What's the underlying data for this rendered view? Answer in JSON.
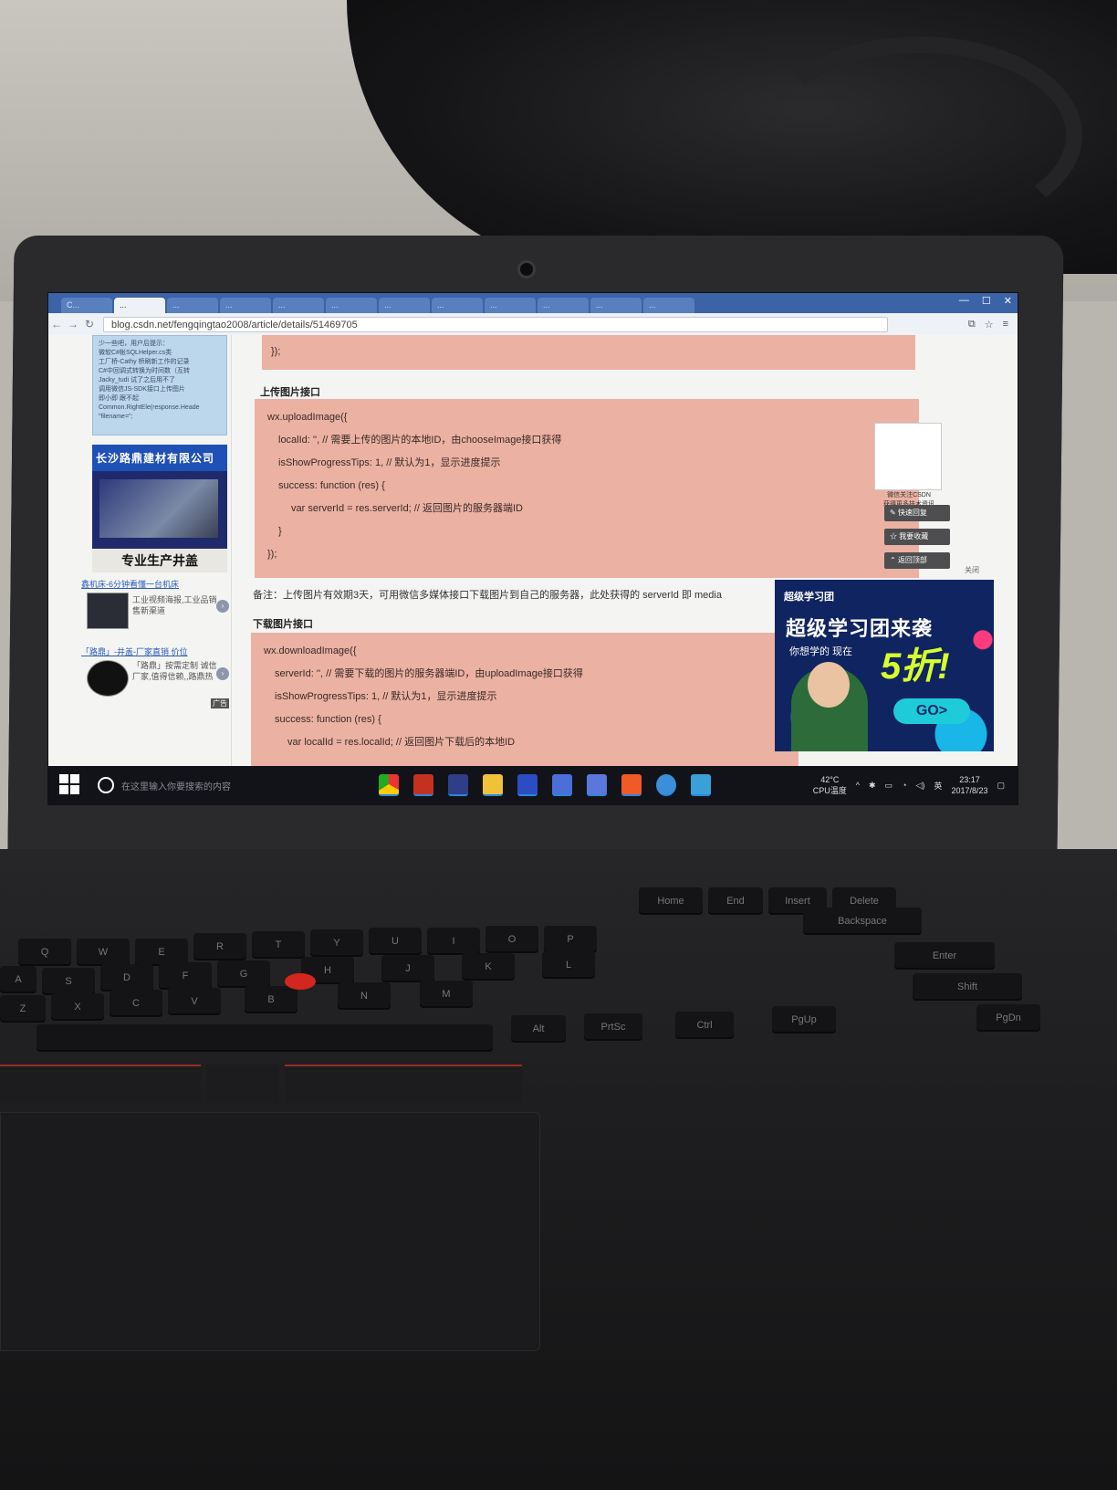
{
  "browser": {
    "url": "blog.csdn.net/fengqingtao2008/article/details/51469705",
    "tabs": [
      "C...",
      "...",
      "...",
      "...",
      "...",
      "...",
      "...",
      "...",
      "...",
      "...",
      "...",
      "..."
    ]
  },
  "sidebar": {
    "box_lines": [
      "少一些吧，用户后提示：",
      "微软C#帐SQLHelper.cs类",
      "工厂桥-Cathy 桥刷新工作的记录",
      "C#中回调式转换为时间数（互转",
      "Jacky_tudi 试了之后用不了",
      "调用微信JS-SDK接口上传图片",
      "即小即 跟不起",
      "Common.RightEle(response.Heade",
      "\"filename=\";"
    ],
    "ad_company": "长沙路鼎建材有限公司",
    "ad_tagline": "专业生产井盖",
    "promo1_link": "鑫机床-6分钟看懂一台机床",
    "promo1_desc": "工业视频海报,工业品销售新渠道",
    "promo2_link": "「路鼎」-井盖-厂家直销 价位",
    "promo2_desc": "「路鼎」按需定制 诚信厂家,值得信赖,,路鼎热",
    "ad_badge": "广告"
  },
  "article": {
    "top_code_end": "});",
    "upload_heading": "上传图片接口",
    "upload_code": [
      "wx.uploadImage({",
      "localId: '', // 需要上传的图片的本地ID，由chooseImage接口获得",
      "isShowProgressTips: 1, // 默认为1，显示进度提示",
      "success: function (res) {",
      "var serverId = res.serverId; // 返回图片的服务器端ID",
      "}",
      "});"
    ],
    "note": "备注：上传图片有效期3天，可用微信多媒体接口下载图片到自己的服务器，此处获得的 serverId 即 media",
    "download_heading": "下载图片接口",
    "download_code": [
      "wx.downloadImage({",
      "serverId: '', // 需要下载的图片的服务器端ID，由uploadImage接口获得",
      "isShowProgressTips: 1, // 默认为1，显示进度提示",
      "success: function (res) {",
      "var localId = res.localId; // 返回图片下载后的本地ID"
    ]
  },
  "floating": {
    "qr_caption_1": "微信关注CSDN",
    "qr_caption_2": "获得更多技术资讯",
    "btn_reply": "快速回复",
    "btn_collect": "我要收藏",
    "btn_top": "返回顶部",
    "close": "关闭"
  },
  "promo": {
    "logo": "超级学习团",
    "title": "超级学习团来袭",
    "sub": "你想学的 现在",
    "discount": "5折!",
    "go": "GO>"
  },
  "taskbar": {
    "search_placeholder": "在这里输入你要搜索的内容",
    "temp": "42°C",
    "temp_label": "CPU温度",
    "ime": "英",
    "time": "23:17",
    "date": "2017/8/23"
  },
  "keyboard": {
    "row_top": [
      "Home",
      "End",
      "Insert",
      "Delete",
      "Backspace"
    ],
    "row_q": [
      "Q",
      "W",
      "E",
      "R",
      "T",
      "Y",
      "U",
      "I",
      "O",
      "P"
    ],
    "row_a": [
      "A",
      "S",
      "D",
      "F",
      "G",
      "H",
      "J",
      "K",
      "L"
    ],
    "row_z": [
      "Z",
      "X",
      "C",
      "V",
      "B",
      "N",
      "M"
    ],
    "mods": [
      "Alt",
      "PrtSc",
      "Ctrl",
      "PgUp",
      "PgDn",
      "Enter",
      "Shift"
    ]
  }
}
